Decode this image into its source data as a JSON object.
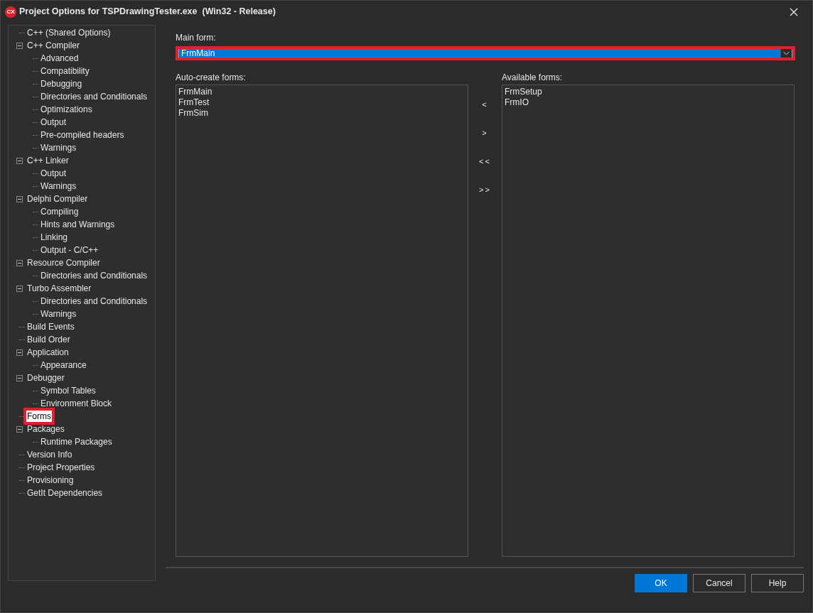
{
  "window": {
    "title": "Project Options for TSPDrawingTester.exe  (Win32 - Release)",
    "logo": "CX"
  },
  "tree": [
    {
      "label": "C++ (Shared Options)",
      "selected": false,
      "highlighted": false
    },
    {
      "label": "C++ Compiler",
      "selected": false,
      "highlighted": false,
      "expanded": true,
      "children": [
        {
          "label": "Advanced",
          "selected": false,
          "highlighted": false
        },
        {
          "label": "Compatibility",
          "selected": false,
          "highlighted": false
        },
        {
          "label": "Debugging",
          "selected": false,
          "highlighted": false
        },
        {
          "label": "Directories and Conditionals",
          "selected": false,
          "highlighted": false
        },
        {
          "label": "Optimizations",
          "selected": false,
          "highlighted": false
        },
        {
          "label": "Output",
          "selected": false,
          "highlighted": false
        },
        {
          "label": "Pre-compiled headers",
          "selected": false,
          "highlighted": false
        },
        {
          "label": "Warnings",
          "selected": false,
          "highlighted": false
        }
      ]
    },
    {
      "label": "C++ Linker",
      "selected": false,
      "highlighted": false,
      "expanded": true,
      "children": [
        {
          "label": "Output",
          "selected": false,
          "highlighted": false
        },
        {
          "label": "Warnings",
          "selected": false,
          "highlighted": false
        }
      ]
    },
    {
      "label": "Delphi Compiler",
      "selected": false,
      "highlighted": false,
      "expanded": true,
      "children": [
        {
          "label": "Compiling",
          "selected": false,
          "highlighted": false
        },
        {
          "label": "Hints and Warnings",
          "selected": false,
          "highlighted": false
        },
        {
          "label": "Linking",
          "selected": false,
          "highlighted": false
        },
        {
          "label": "Output - C/C++",
          "selected": false,
          "highlighted": false
        }
      ]
    },
    {
      "label": "Resource Compiler",
      "selected": false,
      "highlighted": false,
      "expanded": true,
      "children": [
        {
          "label": "Directories and Conditionals",
          "selected": false,
          "highlighted": false
        }
      ]
    },
    {
      "label": "Turbo Assembler",
      "selected": false,
      "highlighted": false,
      "expanded": true,
      "children": [
        {
          "label": "Directories and Conditionals",
          "selected": false,
          "highlighted": false
        },
        {
          "label": "Warnings",
          "selected": false,
          "highlighted": false
        }
      ]
    },
    {
      "label": "Build Events",
      "selected": false,
      "highlighted": false
    },
    {
      "label": "Build Order",
      "selected": false,
      "highlighted": false
    },
    {
      "label": "Application",
      "selected": false,
      "highlighted": false,
      "expanded": true,
      "children": [
        {
          "label": "Appearance",
          "selected": false,
          "highlighted": false
        }
      ]
    },
    {
      "label": "Debugger",
      "selected": false,
      "highlighted": false,
      "expanded": true,
      "children": [
        {
          "label": "Symbol Tables",
          "selected": false,
          "highlighted": false
        },
        {
          "label": "Environment Block",
          "selected": false,
          "highlighted": false
        }
      ]
    },
    {
      "label": "Forms",
      "selected": true,
      "highlighted": true
    },
    {
      "label": "Packages",
      "selected": false,
      "highlighted": false,
      "expanded": true,
      "children": [
        {
          "label": "Runtime Packages",
          "selected": false,
          "highlighted": false
        }
      ]
    },
    {
      "label": "Version Info",
      "selected": false,
      "highlighted": false
    },
    {
      "label": "Project Properties",
      "selected": false,
      "highlighted": false
    },
    {
      "label": "Provisioning",
      "selected": false,
      "highlighted": false
    },
    {
      "label": "GetIt Dependencies",
      "selected": false,
      "highlighted": false
    }
  ],
  "main_form": {
    "label": "Main form:",
    "value": "FrmMain",
    "highlighted": true
  },
  "auto_create": {
    "label": "Auto-create forms:",
    "items": [
      "FrmMain",
      "FrmTest",
      "FrmSim"
    ]
  },
  "move_buttons": [
    "<",
    ">",
    "<<",
    ">>"
  ],
  "available": {
    "label": "Available forms:",
    "items": [
      "FrmSetup",
      "FrmIO"
    ]
  },
  "buttons": [
    {
      "label": "OK",
      "default": true
    },
    {
      "label": "Cancel",
      "default": false
    },
    {
      "label": "Help",
      "default": false
    }
  ]
}
